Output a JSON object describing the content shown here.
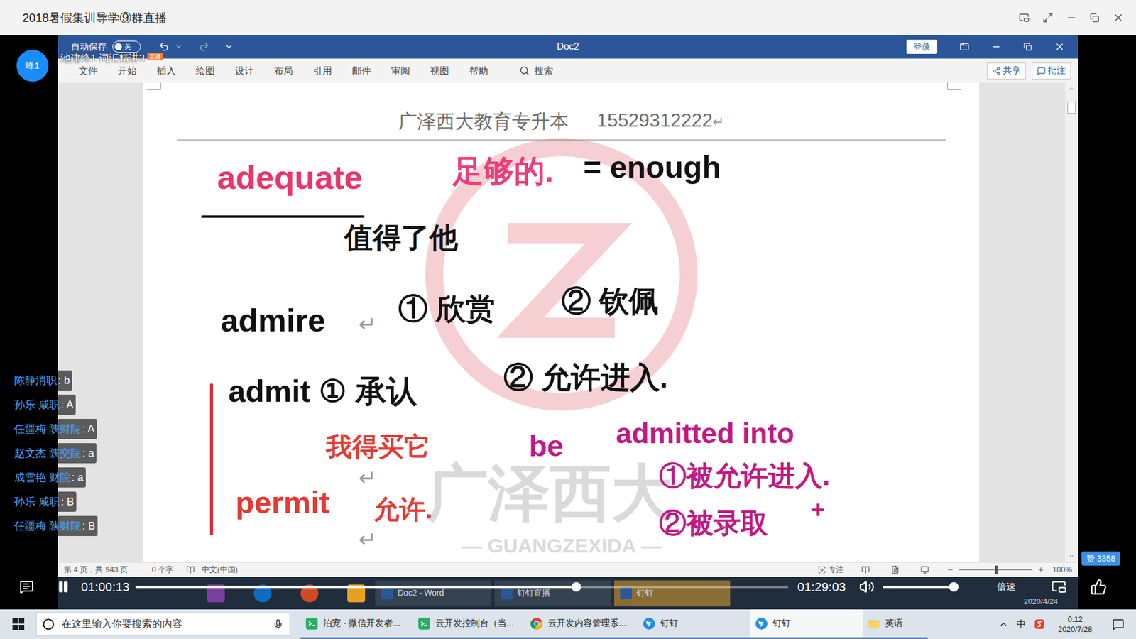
{
  "window": {
    "title": "2018暑假集训导学⑨群直播"
  },
  "presenter": {
    "avatar": "峰1",
    "caption": "池建峰1 词汇精讲3",
    "badge": "直播"
  },
  "word": {
    "autosave": {
      "label": "自动保存",
      "state": "关",
      "on": false
    },
    "title": "Doc2",
    "login": "登录",
    "tabs": [
      {
        "label": "文件",
        "selected": false
      },
      {
        "label": "开始",
        "selected": false
      },
      {
        "label": "插入",
        "selected": false
      },
      {
        "label": "绘图",
        "selected": false
      },
      {
        "label": "设计",
        "selected": false
      },
      {
        "label": "布局",
        "selected": false
      },
      {
        "label": "引用",
        "selected": false
      },
      {
        "label": "邮件",
        "selected": false
      },
      {
        "label": "审阅",
        "selected": false
      },
      {
        "label": "视图",
        "selected": false
      },
      {
        "label": "帮助",
        "selected": false
      }
    ],
    "search": "搜索",
    "share": "共享",
    "comment": "批注",
    "page": {
      "header": "广泽西大教育专升本",
      "phone": "15529312222",
      "mark": "↵",
      "watermark": {
        "name": "广泽西大",
        "latin": "— GUANGZEXIDA —"
      },
      "notes": [
        {
          "text": "adequate",
          "color": "#ea3569"
        },
        {
          "text": "足够的.",
          "color": "#f03c78"
        },
        {
          "text": "= enough",
          "color": "#111111"
        },
        {
          "text": "值得了他",
          "color": "#111111"
        },
        {
          "text": "admire",
          "color": "#111111"
        },
        {
          "text": "① 欣赏",
          "color": "#111111"
        },
        {
          "text": "② 钦佩",
          "color": "#111111"
        },
        {
          "text": "admit ① 承认",
          "color": "#111111"
        },
        {
          "text": "② 允许进入.",
          "color": "#111111"
        },
        {
          "text": "我得买它",
          "color": "#e53935"
        },
        {
          "text": "be",
          "color": "#c21885"
        },
        {
          "text": "admitted into",
          "color": "#c21885"
        },
        {
          "text": "①被允许进入.",
          "color": "#c21885"
        },
        {
          "text": "②被录取",
          "color": "#c21885"
        },
        {
          "text": "+",
          "color": "#c21885"
        },
        {
          "text": "permit",
          "color": "#e53935"
        },
        {
          "text": "允许.",
          "color": "#e53935"
        }
      ],
      "paragraph_marks": [
        "↵",
        "↵",
        "↵"
      ]
    },
    "status": {
      "page": "第 4 页，共 943 页",
      "words": "0 个字",
      "language": "中文(中国)",
      "focus": "专注",
      "zoom": "100%",
      "zoom_level": 0.5
    },
    "scroll": 0.02
  },
  "recorded_taskbar": {
    "buttons": [
      {
        "label": "Doc2 - Word",
        "selected": false
      },
      {
        "label": "钉钉直播",
        "selected": false
      },
      {
        "label": "钉钉",
        "selected": true
      }
    ],
    "date": "2020/4/24"
  },
  "chat": [
    {
      "name": "陈静渭职",
      "message": ": b"
    },
    {
      "name": "孙乐 咸职",
      "message": ": A"
    },
    {
      "name": "任疆梅 陕财院",
      "message": ": A"
    },
    {
      "name": "赵文杰 陕交院",
      "message": ": a"
    },
    {
      "name": "成雪艳 财院",
      "message": ": a"
    },
    {
      "name": "孙乐 咸职",
      "message": ": B"
    },
    {
      "name": "任疆梅 陕财院",
      "message": ": B"
    }
  ],
  "player": {
    "playing": true,
    "elapsed": "01:00:13",
    "duration": "01:29:03",
    "progress": 0.676,
    "volume": 0.98,
    "speed": "倍速",
    "likes": {
      "label": "赞",
      "count": "3358"
    }
  },
  "taskbar": {
    "search": "在这里输入你要搜索的内容",
    "apps": [
      {
        "label": "泊宠 - 微信开发者...",
        "selected": false,
        "kind": "wechat"
      },
      {
        "label": "云开发控制台（当...",
        "selected": false,
        "kind": "wechat"
      },
      {
        "label": "云开发内容管理系...",
        "selected": false,
        "kind": "chrome"
      },
      {
        "label": "钉钉",
        "selected": false,
        "kind": "dingtalk"
      },
      {
        "label": "钉钉",
        "selected": true,
        "kind": "dingtalk"
      },
      {
        "label": "英语",
        "selected": false,
        "kind": "folder"
      }
    ],
    "ime": "中",
    "time": "0:12",
    "date": "2020/7/28"
  }
}
